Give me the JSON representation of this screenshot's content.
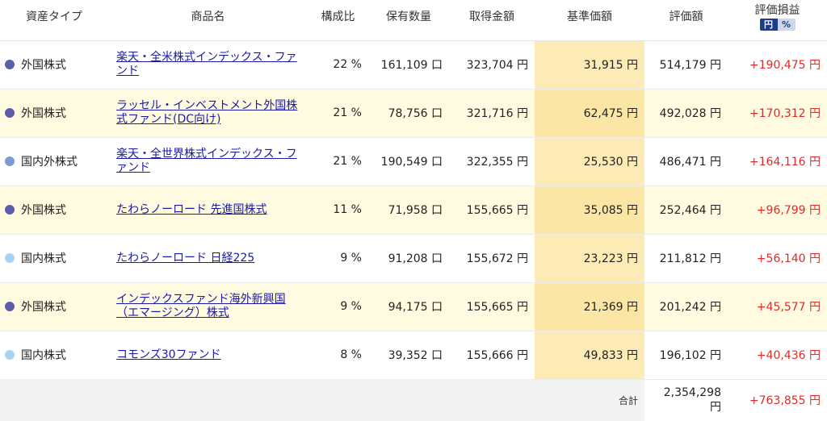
{
  "header": {
    "type": "資産タイプ",
    "name": "商品名",
    "ratio": "構成比",
    "qty": "保有数量",
    "cost": "取得金額",
    "base": "基準価額",
    "value": "評価額",
    "gain": "評価損益",
    "toggle_yen": "円",
    "toggle_pct": "%"
  },
  "colors": {
    "foreign": "#5b5fa8",
    "global": "#7f9bd4",
    "domestic": "#a9d3f2",
    "gain": "#e02a2a"
  },
  "rows": [
    {
      "type": "外国株式",
      "dot": "foreign",
      "name": "楽天・全米株式インデックス・ファンド",
      "ratio": "22 %",
      "qty": "161,109 口",
      "cost": "323,704 円",
      "base": "31,915 円",
      "value": "514,179 円",
      "gain": "+190,475 円"
    },
    {
      "type": "外国株式",
      "dot": "foreign",
      "name": "ラッセル・インベストメント外国株式ファンド(DC向け)",
      "ratio": "21 %",
      "qty": "78,756 口",
      "cost": "321,716 円",
      "base": "62,475 円",
      "value": "492,028 円",
      "gain": "+170,312 円"
    },
    {
      "type": "国内外株式",
      "dot": "global",
      "name": "楽天・全世界株式インデックス・ファンド",
      "ratio": "21 %",
      "qty": "190,549 口",
      "cost": "322,355 円",
      "base": "25,530 円",
      "value": "486,471 円",
      "gain": "+164,116 円"
    },
    {
      "type": "外国株式",
      "dot": "foreign",
      "name": "たわらノーロード 先進国株式",
      "ratio": "11 %",
      "qty": "71,958 口",
      "cost": "155,665 円",
      "base": "35,085 円",
      "value": "252,464 円",
      "gain": "+96,799 円"
    },
    {
      "type": "国内株式",
      "dot": "domestic",
      "name": "たわらノーロード 日経225",
      "ratio": "9 %",
      "qty": "91,208 口",
      "cost": "155,672 円",
      "base": "23,223 円",
      "value": "211,812 円",
      "gain": "+56,140 円"
    },
    {
      "type": "外国株式",
      "dot": "foreign",
      "name": "インデックスファンド海外新興国（エマージング）株式",
      "ratio": "9 %",
      "qty": "94,175 口",
      "cost": "155,665 円",
      "base": "21,369 円",
      "value": "201,242 円",
      "gain": "+45,577 円"
    },
    {
      "type": "国内株式",
      "dot": "domestic",
      "name": "コモンズ30ファンド",
      "ratio": "8 %",
      "qty": "39,352 口",
      "cost": "155,666 円",
      "base": "49,833 円",
      "value": "196,102 円",
      "gain": "+40,436 円"
    }
  ],
  "total": {
    "label": "合計",
    "value_num": "2,354,298",
    "value_unit": "円",
    "gain": "+763,855 円"
  }
}
